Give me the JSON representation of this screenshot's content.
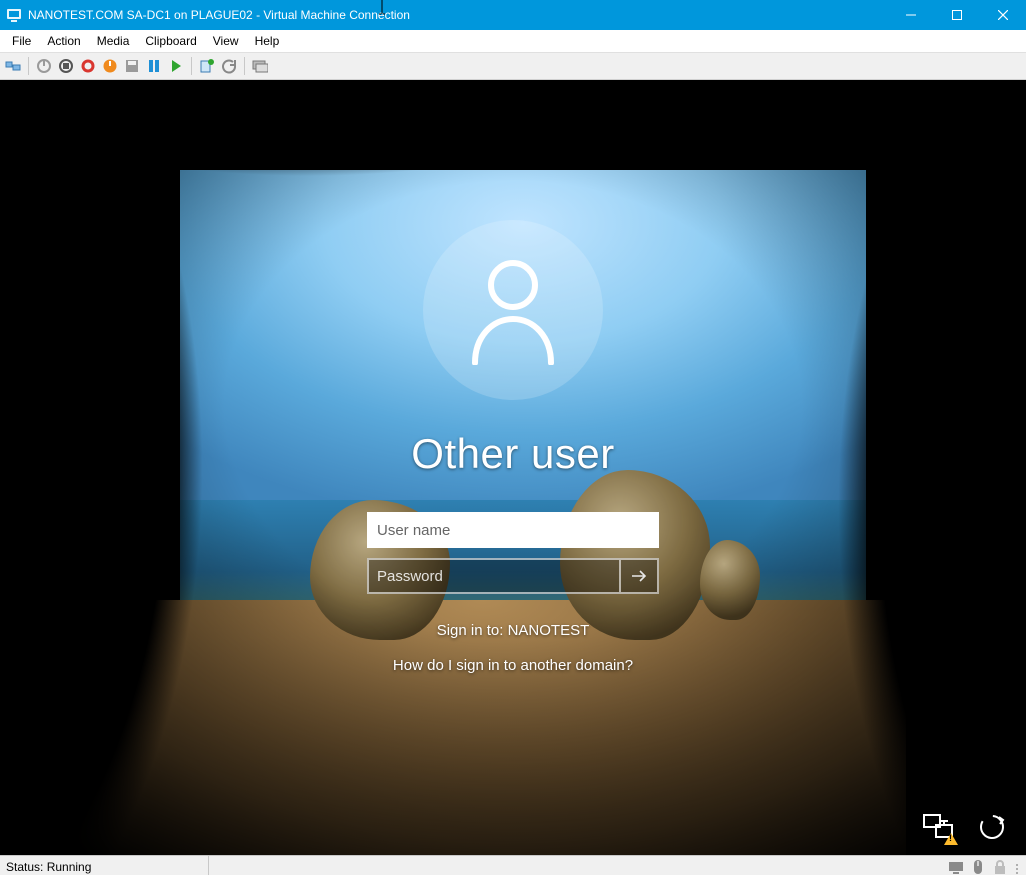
{
  "window": {
    "title": "NANOTEST.COM SA-DC1 on PLAGUE02 - Virtual Machine Connection"
  },
  "menu": {
    "items": [
      "File",
      "Action",
      "Media",
      "Clipboard",
      "View",
      "Help"
    ]
  },
  "toolbar": {
    "icons": [
      "ctrl-alt-del-icon",
      "start-icon",
      "turnoff-icon",
      "shutdown-icon",
      "reset-icon",
      "save-icon",
      "pause-icon",
      "play-icon",
      "checkpoint-icon",
      "revert-icon",
      "enhanced-session-icon"
    ]
  },
  "login": {
    "user_title": "Other user",
    "username_placeholder": "User name",
    "password_placeholder": "Password",
    "signin_to": "Sign in to: NANOTEST",
    "domain_link": "How do I sign in to another domain?"
  },
  "status": {
    "text": "Status: Running"
  }
}
